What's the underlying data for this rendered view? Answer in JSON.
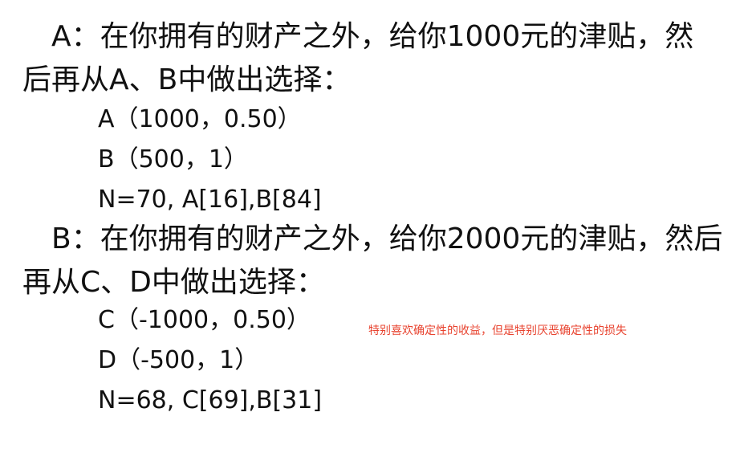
{
  "section_a": {
    "intro_line1": "A：在你拥有的财产之外，给你1000元的津贴，然",
    "intro_line2": "后再从A、B中做出选择：",
    "option_a": "A（1000，0.50）",
    "option_b": "B（500，1）",
    "result": "N=70, A[16],B[84]"
  },
  "section_b": {
    "intro_line1": "B：在你拥有的财产之外，给你2000元的津贴，然后",
    "intro_line2": "再从C、D中做出选择：",
    "option_c": "C（-1000，0.50）",
    "option_d": "D（-500，1）",
    "result": "N=68, C[69],B[31]"
  },
  "annotation": {
    "text": "特别喜欢确定性的收益，但是特别厌恶确定性的损失",
    "color": "#e8432f"
  }
}
